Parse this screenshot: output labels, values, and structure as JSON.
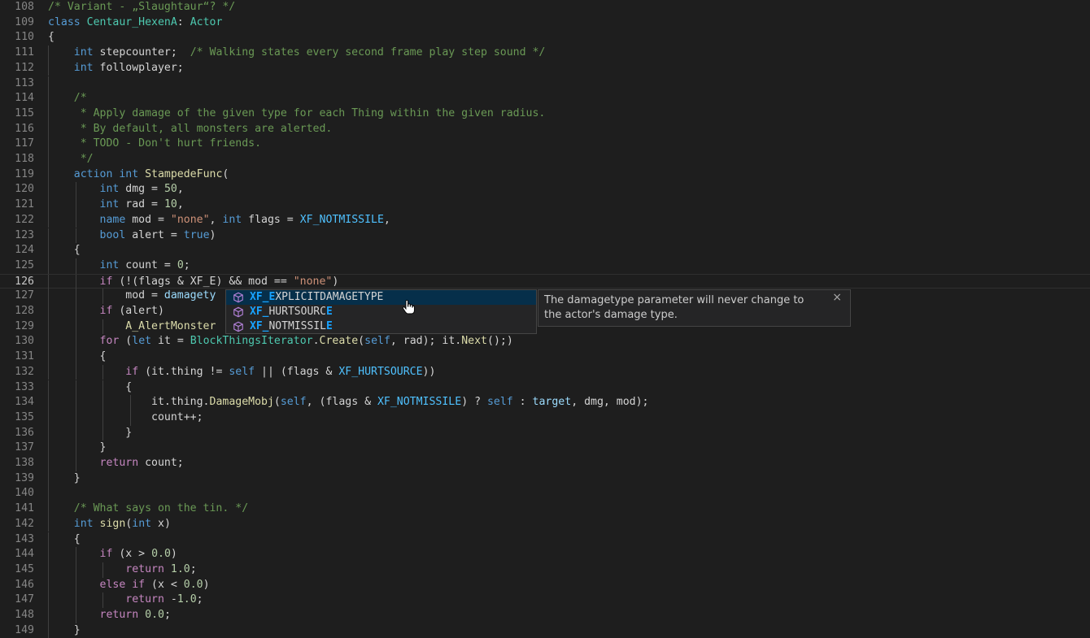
{
  "editor": {
    "lines": [
      {
        "n": "108",
        "tokens": [
          [
            "t-cmt",
            "/* Variant - „Slaughtaur“? */"
          ]
        ],
        "indent": 0
      },
      {
        "n": "109",
        "tokens": [
          [
            "t-kw",
            "class "
          ],
          [
            "t-type",
            "Centaur_HexenA"
          ],
          [
            "t-plain",
            ": "
          ],
          [
            "t-type",
            "Actor"
          ]
        ],
        "indent": 0
      },
      {
        "n": "110",
        "tokens": [
          [
            "t-plain",
            "{"
          ]
        ],
        "indent": 0
      },
      {
        "n": "111",
        "tokens": [
          [
            "t-plain",
            "    "
          ],
          [
            "t-kw",
            "int"
          ],
          [
            "t-plain",
            " stepcounter;  "
          ],
          [
            "t-cmt",
            "/* Walking states every second frame play step sound */"
          ]
        ],
        "indent": 1
      },
      {
        "n": "112",
        "tokens": [
          [
            "t-plain",
            "    "
          ],
          [
            "t-kw",
            "int"
          ],
          [
            "t-plain",
            " followplayer;"
          ]
        ],
        "indent": 1
      },
      {
        "n": "113",
        "tokens": [],
        "indent": 1
      },
      {
        "n": "114",
        "tokens": [
          [
            "t-plain",
            "    "
          ],
          [
            "t-cmt",
            "/*"
          ]
        ],
        "indent": 1
      },
      {
        "n": "115",
        "tokens": [
          [
            "t-plain",
            "    "
          ],
          [
            "t-cmt",
            " * Apply damage of the given type for each Thing within the given radius."
          ]
        ],
        "indent": 1
      },
      {
        "n": "116",
        "tokens": [
          [
            "t-plain",
            "    "
          ],
          [
            "t-cmt",
            " * By default, all monsters are alerted."
          ]
        ],
        "indent": 1
      },
      {
        "n": "117",
        "tokens": [
          [
            "t-plain",
            "    "
          ],
          [
            "t-cmt",
            " * TODO - Don't hurt friends."
          ]
        ],
        "indent": 1
      },
      {
        "n": "118",
        "tokens": [
          [
            "t-plain",
            "    "
          ],
          [
            "t-cmt",
            " */"
          ]
        ],
        "indent": 1
      },
      {
        "n": "119",
        "tokens": [
          [
            "t-plain",
            "    "
          ],
          [
            "t-kw",
            "action int "
          ],
          [
            "t-fn",
            "StampedeFunc"
          ],
          [
            "t-plain",
            "("
          ]
        ],
        "indent": 1
      },
      {
        "n": "120",
        "tokens": [
          [
            "t-plain",
            "        "
          ],
          [
            "t-kw",
            "int"
          ],
          [
            "t-plain",
            " dmg = "
          ],
          [
            "t-num",
            "50"
          ],
          [
            "t-plain",
            ","
          ]
        ],
        "indent": 2
      },
      {
        "n": "121",
        "tokens": [
          [
            "t-plain",
            "        "
          ],
          [
            "t-kw",
            "int"
          ],
          [
            "t-plain",
            " rad = "
          ],
          [
            "t-num",
            "10"
          ],
          [
            "t-plain",
            ","
          ]
        ],
        "indent": 2
      },
      {
        "n": "122",
        "tokens": [
          [
            "t-plain",
            "        "
          ],
          [
            "t-kw",
            "name"
          ],
          [
            "t-plain",
            " mod = "
          ],
          [
            "t-str",
            "\"none\""
          ],
          [
            "t-plain",
            ", "
          ],
          [
            "t-kw",
            "int"
          ],
          [
            "t-plain",
            " flags = "
          ],
          [
            "t-const",
            "XF_NOTMISSILE"
          ],
          [
            "t-plain",
            ","
          ]
        ],
        "indent": 2
      },
      {
        "n": "123",
        "tokens": [
          [
            "t-plain",
            "        "
          ],
          [
            "t-kw",
            "bool"
          ],
          [
            "t-plain",
            " alert = "
          ],
          [
            "t-kw",
            "true"
          ],
          [
            "t-plain",
            ")"
          ]
        ],
        "indent": 2
      },
      {
        "n": "124",
        "tokens": [
          [
            "t-plain",
            "    {"
          ]
        ],
        "indent": 1
      },
      {
        "n": "125",
        "tokens": [
          [
            "t-plain",
            "        "
          ],
          [
            "t-kw",
            "int"
          ],
          [
            "t-plain",
            " count = "
          ],
          [
            "t-num",
            "0"
          ],
          [
            "t-plain",
            ";"
          ]
        ],
        "indent": 2
      },
      {
        "n": "126",
        "tokens": [
          [
            "t-plain",
            "        "
          ],
          [
            "t-ctl",
            "if"
          ],
          [
            "t-plain",
            " (!(flags & XF_E) && mod == "
          ],
          [
            "t-str",
            "\"none\""
          ],
          [
            "t-plain",
            ")"
          ]
        ],
        "indent": 2,
        "current": true
      },
      {
        "n": "127",
        "tokens": [
          [
            "t-plain",
            "            mod = "
          ],
          [
            "t-var",
            "damagety"
          ]
        ],
        "indent": 3
      },
      {
        "n": "128",
        "tokens": [
          [
            "t-plain",
            "        "
          ],
          [
            "t-ctl",
            "if"
          ],
          [
            "t-plain",
            " (alert)"
          ]
        ],
        "indent": 2
      },
      {
        "n": "129",
        "tokens": [
          [
            "t-plain",
            "            "
          ],
          [
            "t-fn",
            "A_AlertMonster"
          ]
        ],
        "indent": 3
      },
      {
        "n": "130",
        "tokens": [
          [
            "t-plain",
            "        "
          ],
          [
            "t-ctl",
            "for"
          ],
          [
            "t-plain",
            " ("
          ],
          [
            "t-kw",
            "let"
          ],
          [
            "t-plain",
            " it = "
          ],
          [
            "t-type",
            "BlockThingsIterator"
          ],
          [
            "t-plain",
            "."
          ],
          [
            "t-fn",
            "Create"
          ],
          [
            "t-plain",
            "("
          ],
          [
            "t-kw",
            "self"
          ],
          [
            "t-plain",
            ", rad); it."
          ],
          [
            "t-fn",
            "Next"
          ],
          [
            "t-plain",
            "();)"
          ]
        ],
        "indent": 2
      },
      {
        "n": "131",
        "tokens": [
          [
            "t-plain",
            "        {"
          ]
        ],
        "indent": 2
      },
      {
        "n": "132",
        "tokens": [
          [
            "t-plain",
            "            "
          ],
          [
            "t-ctl",
            "if"
          ],
          [
            "t-plain",
            " (it.thing != "
          ],
          [
            "t-kw",
            "self"
          ],
          [
            "t-plain",
            " || (flags & "
          ],
          [
            "t-const",
            "XF_HURTSOURCE"
          ],
          [
            "t-plain",
            "))"
          ]
        ],
        "indent": 3
      },
      {
        "n": "133",
        "tokens": [
          [
            "t-plain",
            "            {"
          ]
        ],
        "indent": 3
      },
      {
        "n": "134",
        "tokens": [
          [
            "t-plain",
            "                it.thing."
          ],
          [
            "t-fn",
            "DamageMobj"
          ],
          [
            "t-plain",
            "("
          ],
          [
            "t-kw",
            "self"
          ],
          [
            "t-plain",
            ", (flags & "
          ],
          [
            "t-const",
            "XF_NOTMISSILE"
          ],
          [
            "t-plain",
            ") ? "
          ],
          [
            "t-kw",
            "self"
          ],
          [
            "t-plain",
            " : "
          ],
          [
            "t-var",
            "target"
          ],
          [
            "t-plain",
            ", dmg, mod);"
          ]
        ],
        "indent": 4
      },
      {
        "n": "135",
        "tokens": [
          [
            "t-plain",
            "                count++;"
          ]
        ],
        "indent": 4
      },
      {
        "n": "136",
        "tokens": [
          [
            "t-plain",
            "            }"
          ]
        ],
        "indent": 3
      },
      {
        "n": "137",
        "tokens": [
          [
            "t-plain",
            "        }"
          ]
        ],
        "indent": 2
      },
      {
        "n": "138",
        "tokens": [
          [
            "t-plain",
            "        "
          ],
          [
            "t-ctl",
            "return"
          ],
          [
            "t-plain",
            " count;"
          ]
        ],
        "indent": 2
      },
      {
        "n": "139",
        "tokens": [
          [
            "t-plain",
            "    }"
          ]
        ],
        "indent": 1
      },
      {
        "n": "140",
        "tokens": [],
        "indent": 1
      },
      {
        "n": "141",
        "tokens": [
          [
            "t-plain",
            "    "
          ],
          [
            "t-cmt",
            "/* What says on the tin. */"
          ]
        ],
        "indent": 1
      },
      {
        "n": "142",
        "tokens": [
          [
            "t-plain",
            "    "
          ],
          [
            "t-kw",
            "int"
          ],
          [
            "t-plain",
            " "
          ],
          [
            "t-fn",
            "sign"
          ],
          [
            "t-plain",
            "("
          ],
          [
            "t-kw",
            "int"
          ],
          [
            "t-plain",
            " x)"
          ]
        ],
        "indent": 1
      },
      {
        "n": "143",
        "tokens": [
          [
            "t-plain",
            "    {"
          ]
        ],
        "indent": 1
      },
      {
        "n": "144",
        "tokens": [
          [
            "t-plain",
            "        "
          ],
          [
            "t-ctl",
            "if"
          ],
          [
            "t-plain",
            " (x > "
          ],
          [
            "t-num",
            "0.0"
          ],
          [
            "t-plain",
            ")"
          ]
        ],
        "indent": 2
      },
      {
        "n": "145",
        "tokens": [
          [
            "t-plain",
            "            "
          ],
          [
            "t-ctl",
            "return"
          ],
          [
            "t-plain",
            " "
          ],
          [
            "t-num",
            "1.0"
          ],
          [
            "t-plain",
            ";"
          ]
        ],
        "indent": 3
      },
      {
        "n": "146",
        "tokens": [
          [
            "t-plain",
            "        "
          ],
          [
            "t-ctl",
            "else if"
          ],
          [
            "t-plain",
            " (x < "
          ],
          [
            "t-num",
            "0.0"
          ],
          [
            "t-plain",
            ")"
          ]
        ],
        "indent": 2
      },
      {
        "n": "147",
        "tokens": [
          [
            "t-plain",
            "            "
          ],
          [
            "t-ctl",
            "return"
          ],
          [
            "t-plain",
            " -"
          ],
          [
            "t-num",
            "1.0"
          ],
          [
            "t-plain",
            ";"
          ]
        ],
        "indent": 3
      },
      {
        "n": "148",
        "tokens": [
          [
            "t-plain",
            "        "
          ],
          [
            "t-ctl",
            "return"
          ],
          [
            "t-plain",
            " "
          ],
          [
            "t-num",
            "0.0"
          ],
          [
            "t-plain",
            ";"
          ]
        ],
        "indent": 2
      },
      {
        "n": "149",
        "tokens": [
          [
            "t-plain",
            "    }"
          ]
        ],
        "indent": 1
      }
    ]
  },
  "suggest": {
    "items": [
      {
        "match": "XF_E",
        "rest": "XPLICITDAMAGETYPE",
        "selected": true,
        "icon": "field-cube-icon"
      },
      {
        "match": "XF_",
        "rest": "HURTSOURC",
        "match2": "E",
        "icon": "field-cube-icon"
      },
      {
        "match": "XF_",
        "rest": "NOTMISSIL",
        "match2": "E",
        "icon": "field-cube-icon"
      }
    ],
    "details": "The damagetype parameter will never change to the actor's damage type.",
    "close_glyph": "×"
  },
  "colors": {
    "background": "#1e1e1e",
    "selection": "#062f4a",
    "match": "#18a3ff",
    "icon": "#b180d7"
  }
}
